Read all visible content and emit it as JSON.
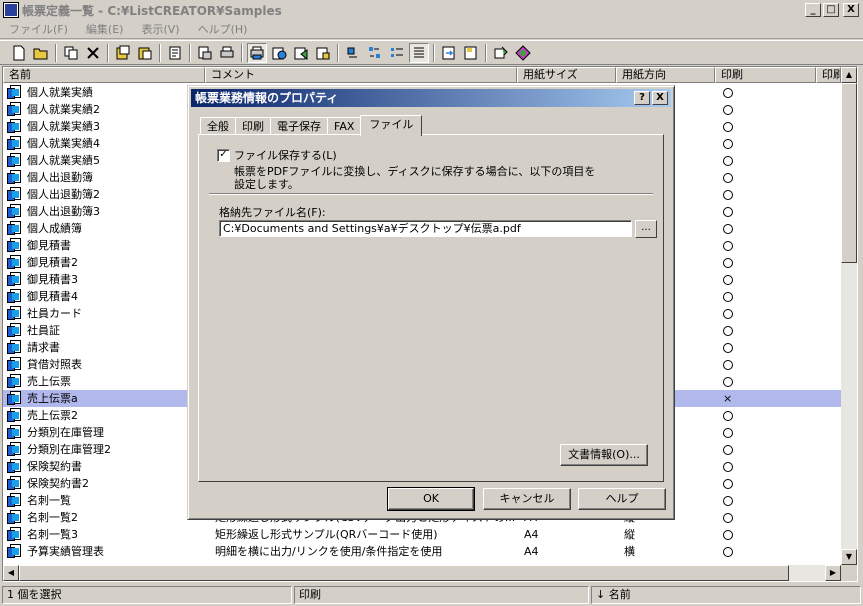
{
  "window": {
    "title": "帳票定義一覧 - C:¥ListCREATOR¥Samples",
    "min": "_",
    "max": "□",
    "close": "X"
  },
  "menu": [
    "ファイル(F)",
    "編集(E)",
    "表示(V)",
    "ヘルプ(H)"
  ],
  "columns": [
    "名前",
    "コメント",
    "用紙サイズ",
    "用紙方向",
    "印刷",
    "印刷"
  ],
  "rows": [
    {
      "name": "個人就業実績",
      "comment": "",
      "paper": "",
      "dir": "",
      "print": "o"
    },
    {
      "name": "個人就業実績2",
      "comment": "",
      "paper": "",
      "dir": "",
      "print": "o"
    },
    {
      "name": "個人就業実績3",
      "comment": "",
      "paper": "",
      "dir": "",
      "print": "o"
    },
    {
      "name": "個人就業実績4",
      "comment": "",
      "paper": "",
      "dir": "",
      "print": "o"
    },
    {
      "name": "個人就業実績5",
      "comment": "",
      "paper": "",
      "dir": "",
      "print": "o"
    },
    {
      "name": "個人出退勤簿",
      "comment": "",
      "paper": "",
      "dir": "",
      "print": "o"
    },
    {
      "name": "個人出退勤簿2",
      "comment": "",
      "paper": "",
      "dir": "",
      "print": "o"
    },
    {
      "name": "個人出退勤簿3",
      "comment": "",
      "paper": "",
      "dir": "",
      "print": "o"
    },
    {
      "name": "個人成績簿",
      "comment": "",
      "paper": "",
      "dir": "",
      "print": "o"
    },
    {
      "name": "御見積書",
      "comment": "",
      "paper": "",
      "dir": "",
      "print": "o"
    },
    {
      "name": "御見積書2",
      "comment": "",
      "paper": "",
      "dir": "",
      "print": "o"
    },
    {
      "name": "御見積書3",
      "comment": "",
      "paper": "",
      "dir": "",
      "print": "o"
    },
    {
      "name": "御見積書4",
      "comment": "",
      "paper": "",
      "dir": "",
      "print": "o"
    },
    {
      "name": "社員カード",
      "comment": "",
      "paper": "",
      "dir": "",
      "print": "o"
    },
    {
      "name": "社員証",
      "comment": "",
      "paper": "",
      "dir": "",
      "print": "o"
    },
    {
      "name": "請求書",
      "comment": "",
      "paper": "",
      "dir": "",
      "print": "o"
    },
    {
      "name": "貸借対照表",
      "comment": "",
      "paper": "",
      "dir": "",
      "print": "o"
    },
    {
      "name": "売上伝票",
      "comment": "",
      "paper": "",
      "dir": "",
      "print": "o"
    },
    {
      "name": "売上伝票a",
      "comment": "",
      "paper": "",
      "dir": "",
      "print": "x",
      "selected": true
    },
    {
      "name": "売上伝票2",
      "comment": "",
      "paper": "",
      "dir": "",
      "print": "o"
    },
    {
      "name": "分類別在庫管理",
      "comment": "",
      "paper": "",
      "dir": "",
      "print": "o"
    },
    {
      "name": "分類別在庫管理2",
      "comment": "",
      "paper": "",
      "dir": "",
      "print": "o"
    },
    {
      "name": "保険契約書",
      "comment": "",
      "paper": "",
      "dir": "",
      "print": "o"
    },
    {
      "name": "保険契約書2",
      "comment": "",
      "paper": "",
      "dir": "",
      "print": "o"
    },
    {
      "name": "名刺一覧",
      "comment": "",
      "paper": "",
      "dir": "",
      "print": "o"
    },
    {
      "name": "名刺一覧2",
      "comment": "矩形繰返し形式サンプル(CSVデータ出力と矩形テキストの...",
      "paper": "A4",
      "dir": "縦",
      "print": "o"
    },
    {
      "name": "名刺一覧3",
      "comment": "矩形繰返し形式サンプル(QRバーコード使用)",
      "paper": "A4",
      "dir": "縦",
      "print": "o"
    },
    {
      "name": "予算実績管理表",
      "comment": "明細を横に出力/リンクを使用/条件指定を使用",
      "paper": "A4",
      "dir": "横",
      "print": "o"
    }
  ],
  "status": {
    "selection": "1 個を選択",
    "print": "印刷",
    "sort": "↓ 名前"
  },
  "dialog": {
    "title": "帳票業務情報のプロパティ",
    "help_btn": "?",
    "close_btn": "X",
    "tabs": [
      "全般",
      "印刷",
      "電子保存",
      "FAX",
      "ファイル"
    ],
    "active_tab": 4,
    "checkbox_label": "ファイル保存する(L)",
    "checkbox_checked": true,
    "description_line1": "帳票をPDFファイルに変換し、ディスクに保存する場合に、以下の項目を",
    "description_line2": "設定します。",
    "field_label": "格納先ファイル名(F):",
    "field_value": "C:¥Documents and Settings¥a¥デスクトップ¥伝票a.pdf",
    "browse_label": "...",
    "doc_info_button": "文書情報(O)...",
    "ok_button": "OK",
    "cancel_button": "キャンセル",
    "help_button": "ヘルプ"
  }
}
